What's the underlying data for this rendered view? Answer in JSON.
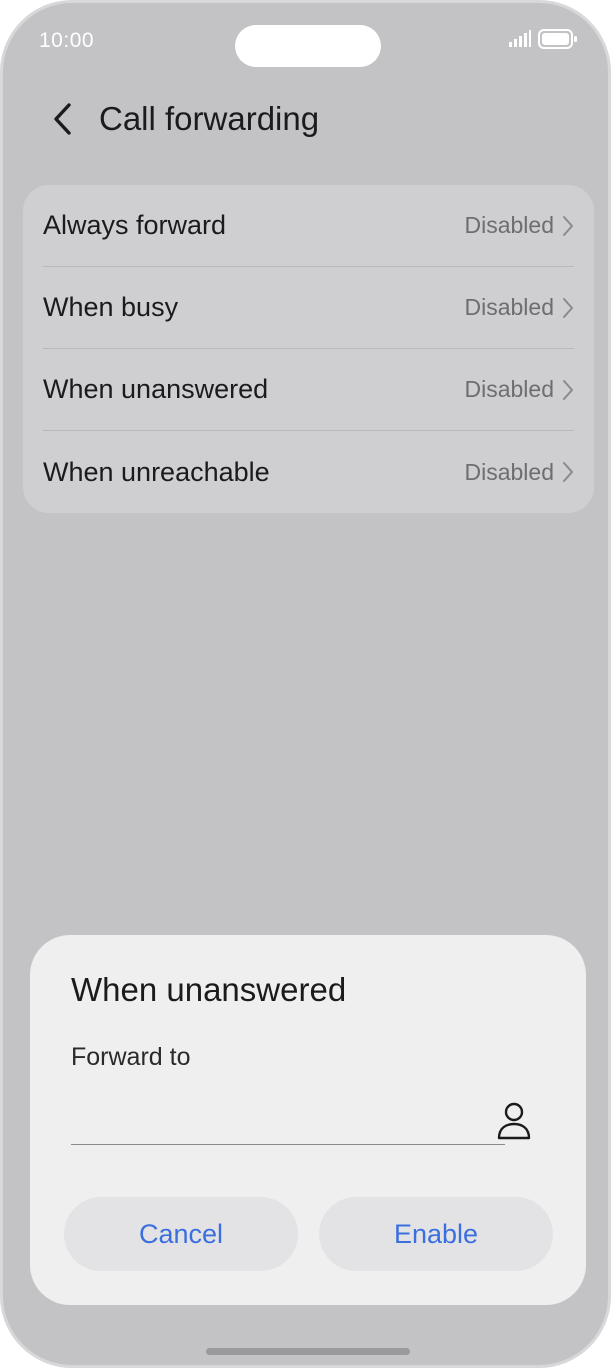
{
  "status_bar": {
    "time": "10:00",
    "signal_icon": "signal-bars-icon",
    "battery_icon": "battery-icon"
  },
  "header": {
    "back_icon": "chevron-left-icon",
    "title": "Call forwarding"
  },
  "settings": {
    "rows": [
      {
        "label": "Always forward",
        "value": "Disabled"
      },
      {
        "label": "When busy",
        "value": "Disabled"
      },
      {
        "label": "When unanswered",
        "value": "Disabled"
      },
      {
        "label": "When unreachable",
        "value": "Disabled"
      }
    ]
  },
  "dialog": {
    "title": "When unanswered",
    "field_label": "Forward to",
    "field_value": "",
    "contact_icon": "person-icon",
    "cancel_label": "Cancel",
    "enable_label": "Enable"
  },
  "colors": {
    "background": "#c3c3c5",
    "card": "#cfcfd1",
    "dialog": "#efefef",
    "accent": "#3b6fde"
  }
}
